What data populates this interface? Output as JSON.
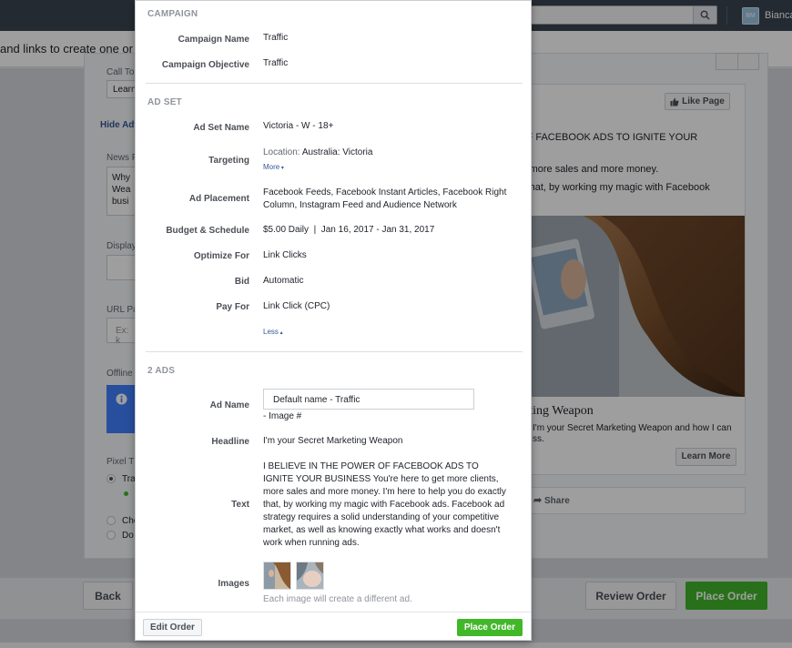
{
  "background": {
    "user_name": "Bianca",
    "avatar_initials": "BM",
    "intro_text": "and links to create one or m",
    "form_labels": {
      "call_to_action": "Call To",
      "call_to_action_value": "Learn",
      "hide_advanced": "Hide Adv",
      "news_feed": "News F",
      "news_feed_text_1": "Why",
      "news_feed_text_2": "Wea",
      "news_feed_text_3": "busi",
      "display": "Display",
      "url_params": "URL Pa",
      "url_placeholder": "Ex: k",
      "offline": "Offline",
      "pixel": "Pixel T",
      "radio_1": "Tra",
      "radio_2": "Che",
      "radio_3": "Do"
    },
    "preview": {
      "like_page": "Like Page",
      "text_line_1": "OF FACEBOOK ADS TO IGNITE YOUR",
      "text_line_2": "s, more sales and more money.",
      "text_line_3": "y that, by working my magic with Facebook",
      "ad_title": "eting Weapon",
      "ad_desc_1": "I'm your Secret Marketing Weapon and how I can",
      "ad_desc_2": "ss.",
      "learn_more": "Learn More",
      "share": "Share"
    },
    "buttons": {
      "back": "Back",
      "review_order": "Review Order",
      "place_order": "Place Order"
    }
  },
  "modal": {
    "campaign": {
      "title": "CAMPAIGN",
      "rows": [
        {
          "label": "Campaign Name",
          "value": "Traffic"
        },
        {
          "label": "Campaign Objective",
          "value": "Traffic"
        }
      ]
    },
    "ad_set": {
      "title": "AD SET",
      "ad_set_name_label": "Ad Set Name",
      "ad_set_name": "Victoria - W - 18+",
      "targeting_label": "Targeting",
      "targeting_location_label": "Location:",
      "targeting_location": "Australia: Victoria",
      "more_link": "More",
      "ad_placement_label": "Ad Placement",
      "ad_placement": "Facebook Feeds, Facebook Instant Articles, Facebook Right Column, Instagram Feed and Audience Network",
      "budget_label": "Budget & Schedule",
      "budget": "$5.00 Daily  |  Jan 16, 2017 - Jan 31, 2017",
      "optimize_label": "Optimize For",
      "optimize": "Link Clicks",
      "bid_label": "Bid",
      "bid": "Automatic",
      "pay_for_label": "Pay For",
      "pay_for": "Link Click (CPC)",
      "less_link": "Less"
    },
    "ads": {
      "title": "2 ADS",
      "ad_name_label": "Ad Name",
      "ad_name_value": "Default name - Traffic",
      "ad_name_suffix": "- Image #",
      "headline_label": "Headline",
      "headline": "I'm your Secret Marketing Weapon",
      "text_label": "Text",
      "text": "I BELIEVE IN THE POWER OF FACEBOOK ADS TO IGNITE YOUR BUSINESS You're here to get more clients, more sales and more money. I'm here to help you do exactly that, by working my magic with Facebook ads. Facebook ad strategy requires a solid understanding of your competitive market, as well as knowing exactly what works and doesn't work when running ads.",
      "images_label": "Images",
      "images_note": "Each image will create a different ad."
    },
    "footer": {
      "edit_order": "Edit Order",
      "place_order": "Place Order"
    }
  }
}
